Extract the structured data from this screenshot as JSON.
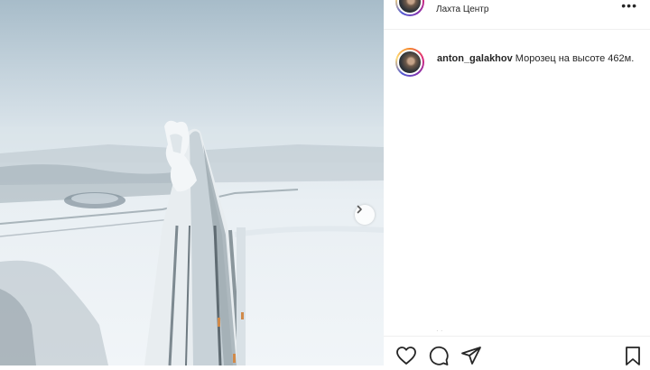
{
  "post": {
    "location": "Лахта Центр",
    "more_icon": "•••"
  },
  "caption": {
    "username": "anton_galakhov",
    "text": " Морозец на высоте 462м."
  },
  "carousel": {
    "next_icon": "chevron-right-icon"
  },
  "footer": {
    "faint_text": "· ·"
  },
  "actions": {
    "like_icon": "heart-icon",
    "comment_icon": "comment-icon",
    "share_icon": "send-icon",
    "save_icon": "bookmark-icon"
  },
  "colors": {
    "text": "#262626",
    "border": "#efefef"
  }
}
